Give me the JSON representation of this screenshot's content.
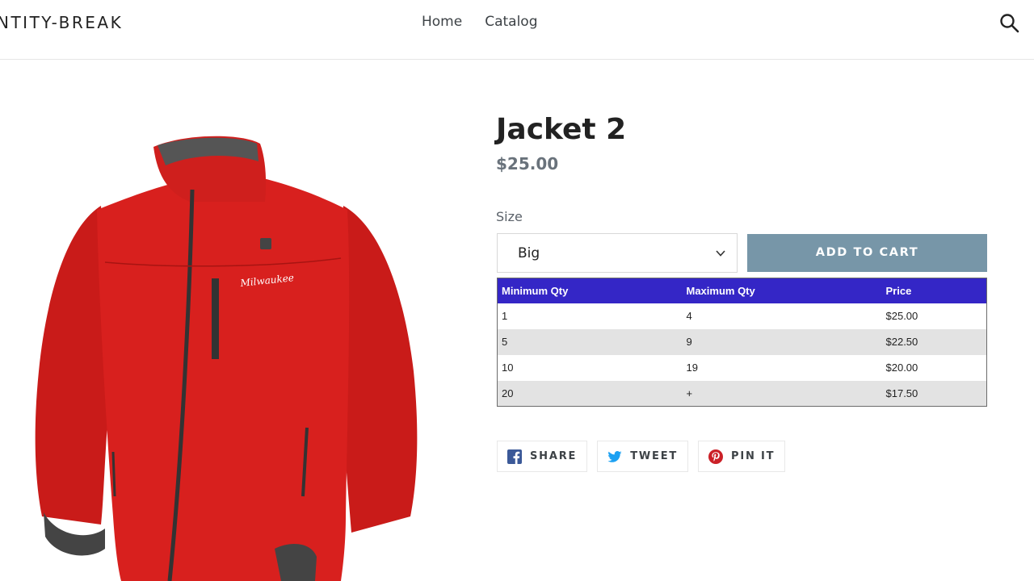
{
  "header": {
    "logo": "NTITY-BREAK",
    "nav": [
      {
        "label": "Home"
      },
      {
        "label": "Catalog"
      }
    ],
    "search_icon": "search-icon"
  },
  "product": {
    "title": "Jacket 2",
    "price": "$25.00",
    "image_logo_text": "Milwaukee",
    "size_label": "Size",
    "size_selected": "Big",
    "add_to_cart": "ADD TO CART",
    "colors": {
      "button": "#7796a8",
      "table_header": "#3426c6",
      "jacket": "#d8201e"
    }
  },
  "tier_table": {
    "headers": [
      "Minimum Qty",
      "Maximum Qty",
      "Price"
    ],
    "rows": [
      [
        "1",
        "4",
        "$25.00"
      ],
      [
        "5",
        "9",
        "$22.50"
      ],
      [
        "10",
        "19",
        "$20.00"
      ],
      [
        "20",
        "+",
        "$17.50"
      ]
    ]
  },
  "share": {
    "facebook": "SHARE",
    "twitter": "TWEET",
    "pinterest": "PIN IT"
  }
}
